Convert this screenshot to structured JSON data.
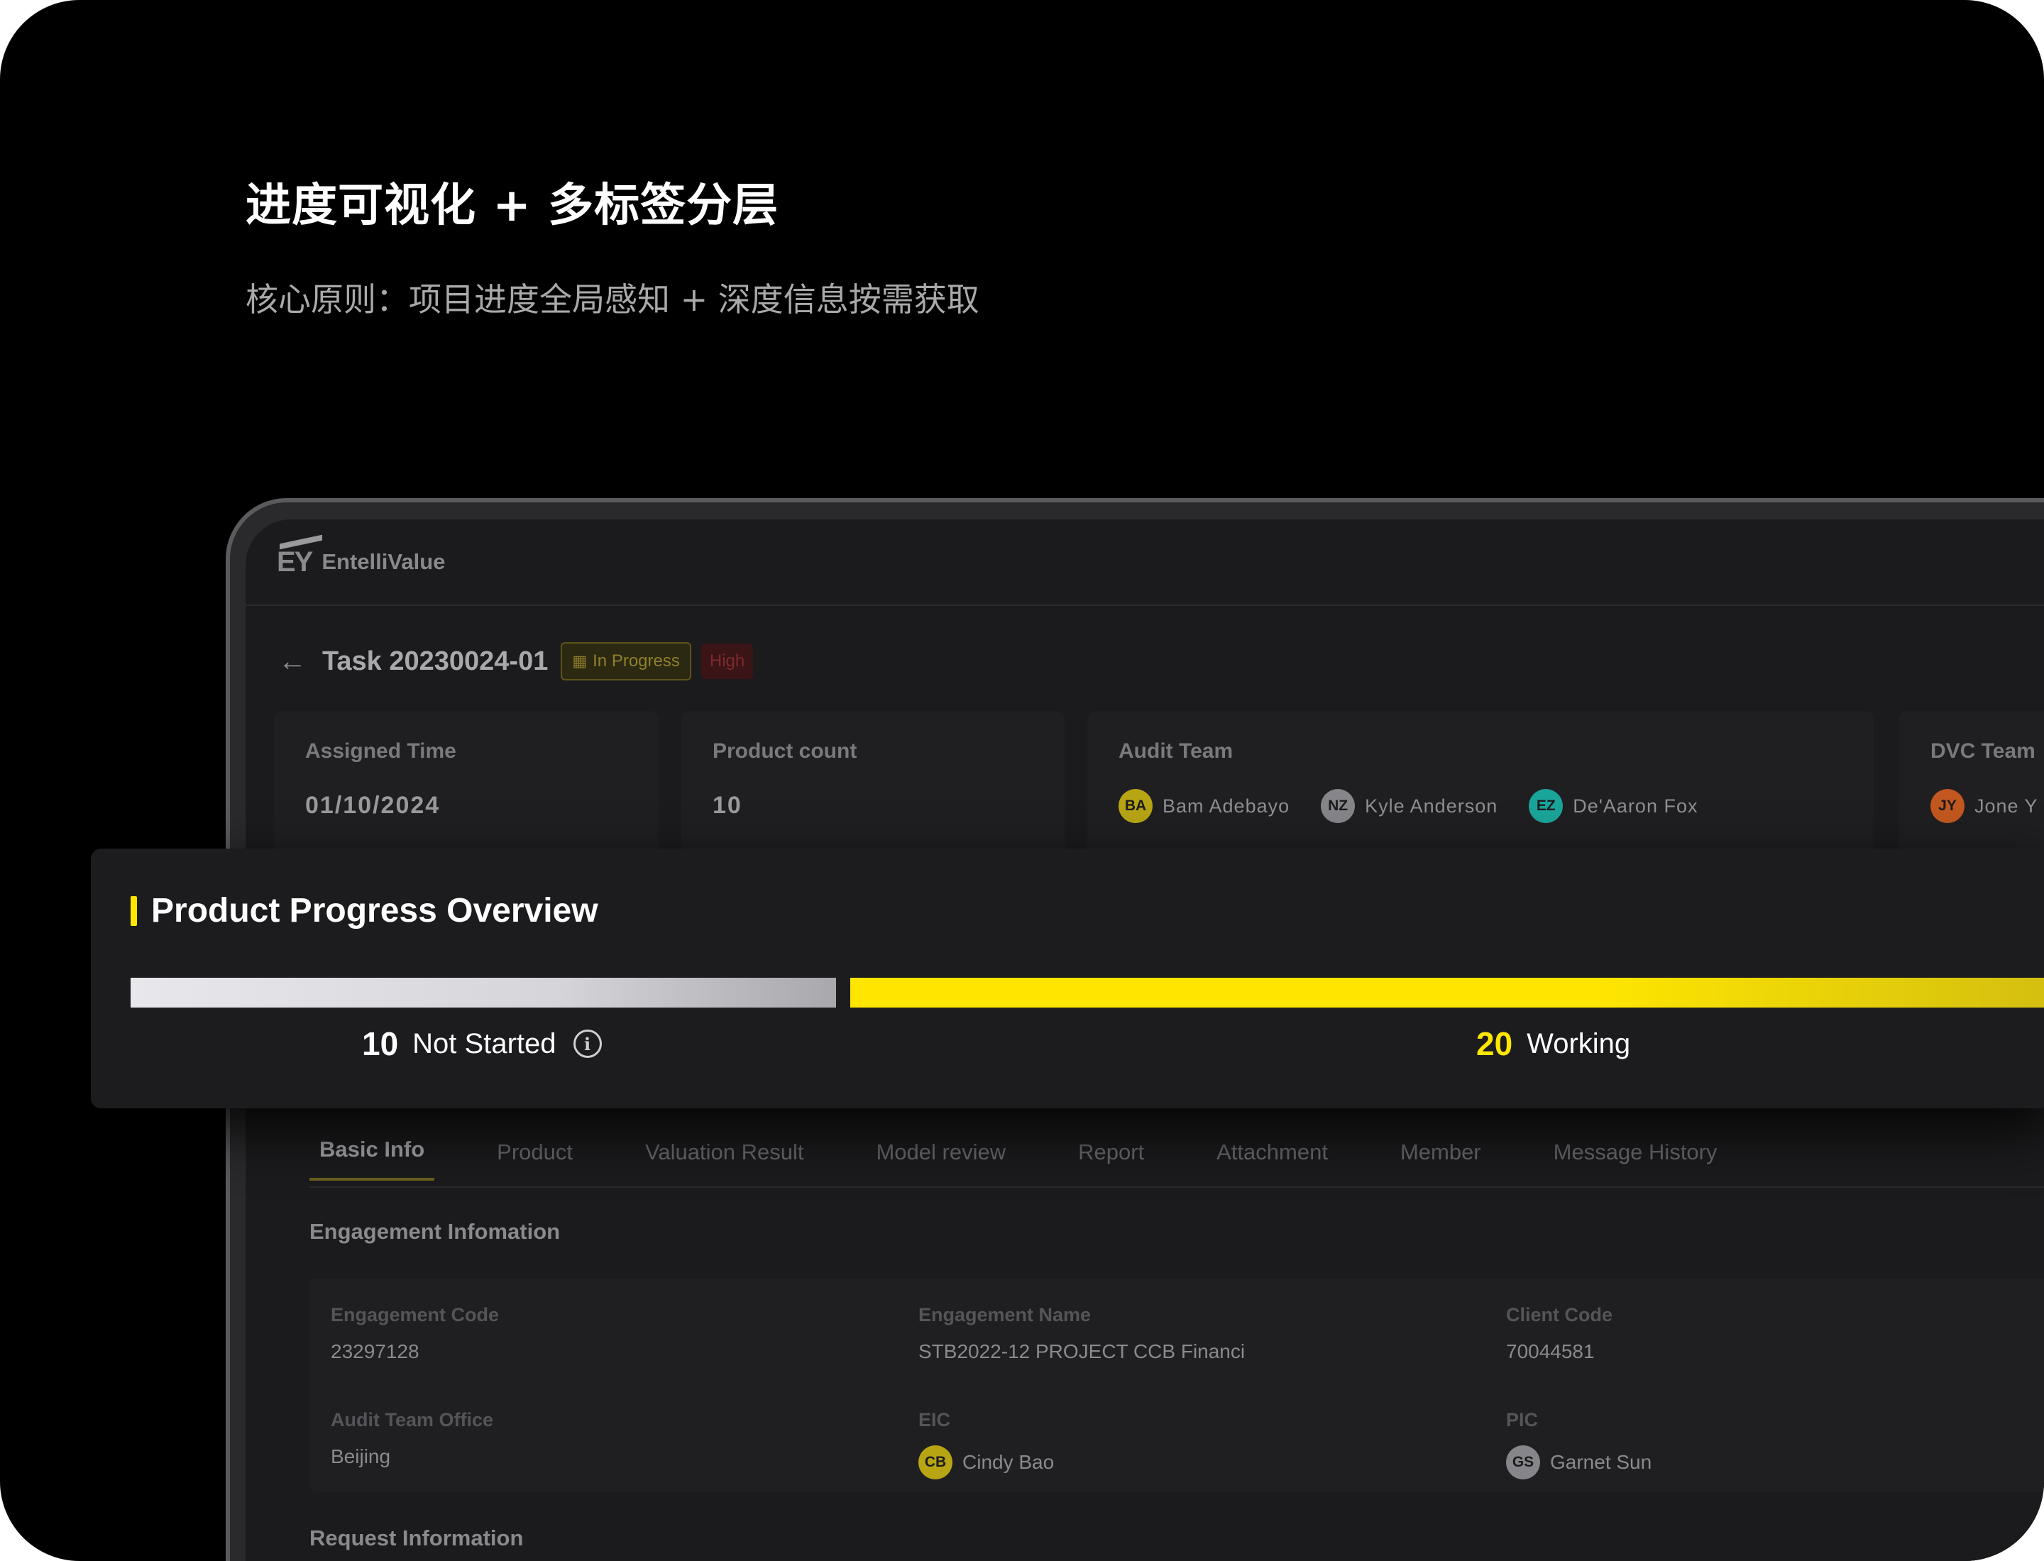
{
  "hero": {
    "title": "进度可视化 + 多标签分层",
    "subtitle": "核心原则：项目进度全局感知 + 深度信息按需获取"
  },
  "app": {
    "logo": "EY",
    "name": "EntelliValue"
  },
  "task": {
    "title": "Task 20230024-01",
    "status": "In Progress",
    "priority": "High"
  },
  "cards": {
    "assigned_time": {
      "label": "Assigned Time",
      "value": "01/10/2024"
    },
    "product_count": {
      "label": "Product count",
      "value": "10"
    },
    "audit_team": {
      "label": "Audit Team",
      "members": [
        {
          "initials": "BA",
          "name": "Bam Adebayo",
          "color": "#b8a514"
        },
        {
          "initials": "NZ",
          "name": "Kyle Anderson",
          "color": "#86868a"
        },
        {
          "initials": "EZ",
          "name": "De'Aaron Fox",
          "color": "#1aa59a"
        }
      ]
    },
    "dvc_team": {
      "label": "DVC Team",
      "members": [
        {
          "initials": "JY",
          "name": "Jone Y",
          "color": "#c2581f"
        }
      ]
    }
  },
  "progress": {
    "title": "Product Progress Overview",
    "not_started": {
      "count": "10",
      "label": "Not Started",
      "color": "#ffffff"
    },
    "working": {
      "count": "20",
      "label": "Working",
      "color": "#ffe600"
    },
    "not_started_fraction": 0.333,
    "working_fraction": 0.667
  },
  "tabs": [
    {
      "label": "Basic Info",
      "active": true
    },
    {
      "label": "Product",
      "active": false
    },
    {
      "label": "Valuation Result",
      "active": false
    },
    {
      "label": "Model review",
      "active": false
    },
    {
      "label": "Report",
      "active": false
    },
    {
      "label": "Attachment",
      "active": false
    },
    {
      "label": "Member",
      "active": false
    },
    {
      "label": "Message History",
      "active": false
    }
  ],
  "engagement": {
    "title": "Engagement Infomation",
    "code": {
      "label": "Engagement Code",
      "value": "23297128"
    },
    "name": {
      "label": "Engagement Name",
      "value": "STB2022-12 PROJECT CCB Financi"
    },
    "client_code": {
      "label": "Client Code",
      "value": "70044581"
    },
    "office": {
      "label": "Audit Team Office",
      "value": "Beijing"
    },
    "eic": {
      "label": "EIC",
      "initials": "CB",
      "value": "Cindy Bao",
      "color": "#b8a514"
    },
    "pic": {
      "label": "PIC",
      "initials": "GS",
      "value": "Garnet Sun",
      "color": "#86868a"
    }
  },
  "request": {
    "title": "Request Information"
  }
}
